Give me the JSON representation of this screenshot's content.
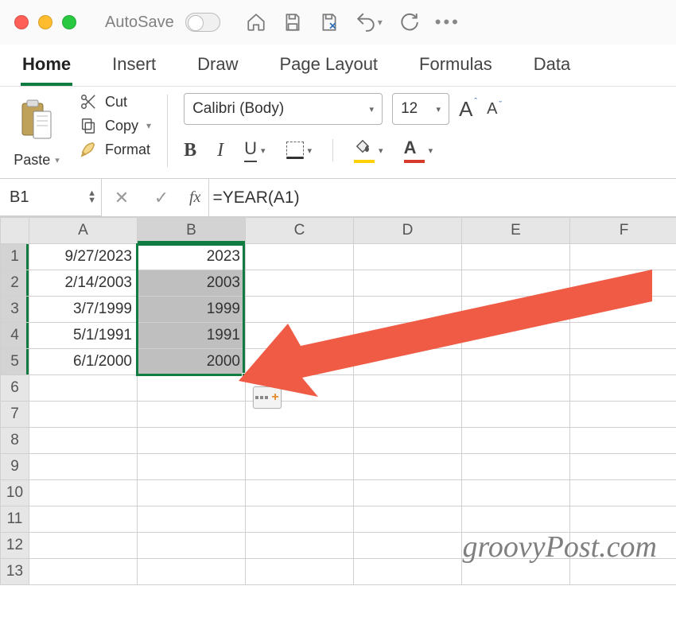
{
  "titlebar": {
    "autosave_label": "AutoSave"
  },
  "ribbon": {
    "tabs": [
      "Home",
      "Insert",
      "Draw",
      "Page Layout",
      "Formulas",
      "Data"
    ],
    "active": "Home",
    "paste_label": "Paste",
    "cut_label": "Cut",
    "copy_label": "Copy",
    "format_label": "Format",
    "font_name": "Calibri (Body)",
    "font_size": "12",
    "bold": "B",
    "italic": "I",
    "underline": "U",
    "font_bigger": "A",
    "font_smaller": "A",
    "font_color_letter": "A"
  },
  "formula_bar": {
    "cell_ref": "B1",
    "fx_label": "fx",
    "formula": "=YEAR(A1)"
  },
  "grid": {
    "columns": [
      "A",
      "B",
      "C",
      "D",
      "E",
      "F"
    ],
    "rows": [
      {
        "n": "1",
        "A": "9/27/2023",
        "B": "2023"
      },
      {
        "n": "2",
        "A": "2/14/2003",
        "B": "2003"
      },
      {
        "n": "3",
        "A": "3/7/1999",
        "B": "1999"
      },
      {
        "n": "4",
        "A": "5/1/1991",
        "B": "1991"
      },
      {
        "n": "5",
        "A": "6/1/2000",
        "B": "2000"
      },
      {
        "n": "6"
      },
      {
        "n": "7"
      },
      {
        "n": "8"
      },
      {
        "n": "9"
      },
      {
        "n": "10"
      },
      {
        "n": "11"
      },
      {
        "n": "12"
      },
      {
        "n": "13"
      }
    ],
    "selected_col": "B",
    "selected_rows": [
      1,
      2,
      3,
      4,
      5
    ],
    "active_cell": "B1"
  },
  "watermark": "groovyPost.com"
}
